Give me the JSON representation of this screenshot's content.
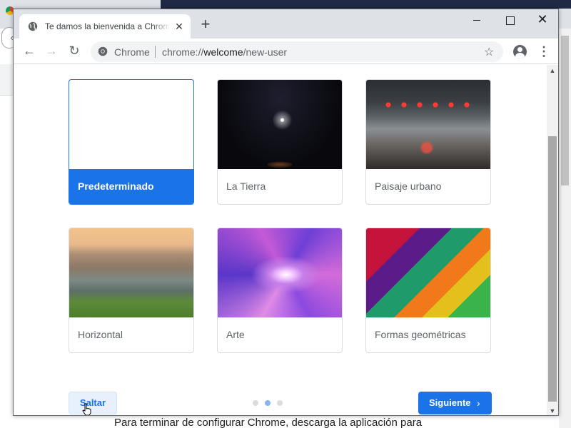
{
  "background": {
    "footer_text": "Para terminar de configurar Chrome, descarga la aplicación para",
    "back_glyph": "‹"
  },
  "browser": {
    "tab_title": "Te damos la bienvenida a Chrome",
    "tab_close_glyph": "✕",
    "new_tab_glyph": "+",
    "window_close_glyph": "✕",
    "nav_back_glyph": "←",
    "nav_forward_glyph": "→",
    "nav_reload_glyph": "↻",
    "menu_glyph": "⋮",
    "star_glyph": "☆",
    "omnibox": {
      "site_name": "Chrome",
      "url_prefix": "chrome://",
      "url_host": "welcome",
      "url_path": "/new-user"
    }
  },
  "page": {
    "backgrounds": [
      {
        "label": "Predeterminado",
        "selected": true,
        "icon": "blank-thumbnail"
      },
      {
        "label": "La Tierra",
        "selected": false,
        "icon": "earth-space-thumbnail"
      },
      {
        "label": "Paisaje urbano",
        "selected": false,
        "icon": "city-street-thumbnail"
      },
      {
        "label": "Horizontal",
        "selected": false,
        "icon": "coastal-landscape-thumbnail"
      },
      {
        "label": "Arte",
        "selected": false,
        "icon": "galaxy-art-thumbnail"
      },
      {
        "label": "Formas geométricas",
        "selected": false,
        "icon": "polygon-thumbnail"
      }
    ],
    "skip_label": "Saltar",
    "next_label": "Siguiente",
    "next_chevron": "›",
    "step_count": 3,
    "current_step": 2,
    "scroll_up_glyph": "▲",
    "scroll_down_glyph": "▼"
  },
  "colors": {
    "accent": "#1a73e8",
    "tab_strip": "#dee1e6",
    "omnibox": "#f1f3f4"
  }
}
